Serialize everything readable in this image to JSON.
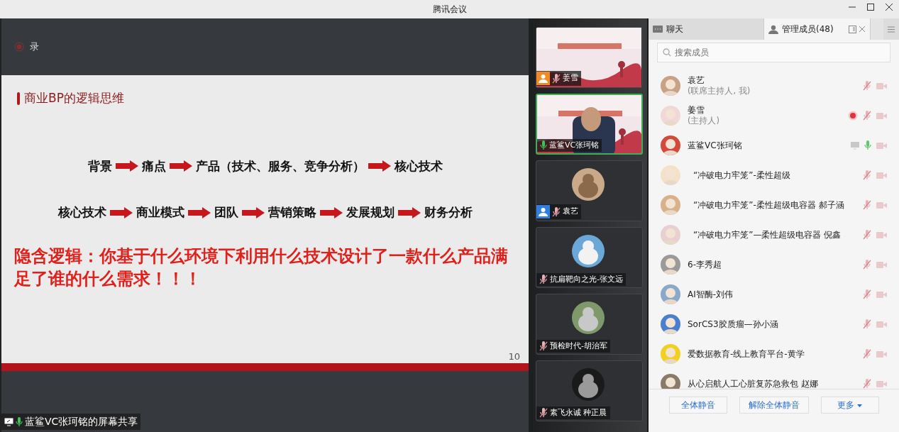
{
  "window": {
    "title": "腾讯会议"
  },
  "recording": {
    "label": "录",
    "on": true
  },
  "slide": {
    "heading": "商业BP的逻辑思维",
    "flows": [
      {
        "steps": [
          "背景",
          "痛点",
          "产品（技术、服务、竞争分析）",
          "核心技术"
        ]
      },
      {
        "steps": [
          "核心技术",
          "商业模式",
          "团队",
          "营销策略",
          "发展规划",
          "财务分析"
        ]
      }
    ],
    "conclusion": "隐含逻辑：你基于什么环境下利用什么技术设计了一款什么产品满足了谁的什么需求！！！",
    "page": "10"
  },
  "share_label": {
    "text": "蓝鲨VC张珂铭的屏幕共享",
    "mic_on": true
  },
  "video_tiles": [
    {
      "name": "姜雪",
      "kind": "video",
      "color": "#f08a24",
      "mic_on": false,
      "selected": false
    },
    {
      "name": "蓝鲨VC张珂铭",
      "kind": "video",
      "mic_on": true,
      "selected": true
    },
    {
      "name": "袁艺",
      "kind": "avatar",
      "color": "#2f7fe0",
      "mic_on": false,
      "selected": false
    },
    {
      "name": "抗扁靶向之光-张文远",
      "kind": "avatar",
      "mic_on": false,
      "selected": false
    },
    {
      "name": "预检时代-胡治军",
      "kind": "avatar",
      "mic_on": false,
      "selected": false
    },
    {
      "name": "素飞永诚 种正晨",
      "kind": "avatar",
      "mic_on": false,
      "selected": false
    }
  ],
  "tabs": [
    {
      "label": "聊天",
      "kind": "chat",
      "selected": false
    },
    {
      "label": "管理成员(48)",
      "kind": "members",
      "selected": true
    }
  ],
  "search": {
    "placeholder": "搜索成员"
  },
  "members": [
    {
      "name": "袁艺",
      "role": "(联席主持人, 我)",
      "mic_on": false,
      "recording": false,
      "sharing": false
    },
    {
      "name": "姜雪",
      "role": "(主持人)",
      "mic_on": false,
      "recording": true,
      "sharing": false
    },
    {
      "name": "蓝鲨VC张珂铭",
      "mic_on": true,
      "recording": false,
      "sharing": true
    },
    {
      "name": "“冲破电力牢笼”-柔性超级",
      "mic_on": false,
      "recording": false,
      "sharing": false
    },
    {
      "name": "“冲破电力牢笼”-柔性超级电容器 郝子涵",
      "mic_on": false,
      "recording": false,
      "sharing": false
    },
    {
      "name": "“冲破电力牢笼”—柔性超级电容器 倪鑫",
      "mic_on": false,
      "recording": false,
      "sharing": false
    },
    {
      "name": "6-李秀超",
      "mic_on": false,
      "recording": false,
      "sharing": false
    },
    {
      "name": "AI智酶-刘伟",
      "mic_on": false,
      "recording": false,
      "sharing": false
    },
    {
      "name": "SorCS3胶质瘤—孙小涵",
      "mic_on": false,
      "recording": false,
      "sharing": false
    },
    {
      "name": "爱数据教育-线上教育平台-黄学",
      "mic_on": false,
      "recording": false,
      "sharing": false
    },
    {
      "name": "从心启航人工心脏复苏急救包 赵娜",
      "mic_on": false,
      "recording": false,
      "sharing": false
    }
  ],
  "buttons": [
    {
      "label": "全体静音"
    },
    {
      "label": "解除全体静音"
    },
    {
      "label": "更多",
      "dropdown": true
    }
  ]
}
